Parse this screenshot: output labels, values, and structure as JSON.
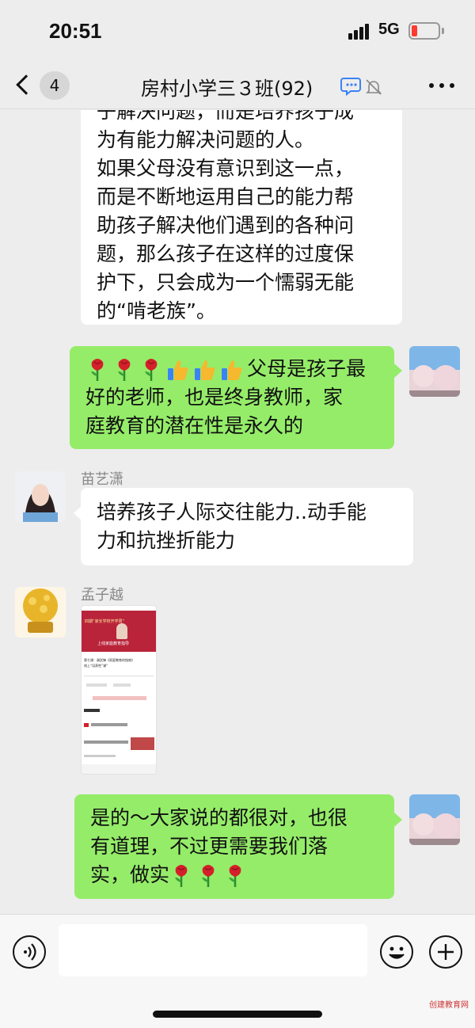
{
  "status_bar": {
    "time": "20:51",
    "network": "5G"
  },
  "nav": {
    "back_count": "4",
    "title": "房村小学三３班(92)"
  },
  "messages": [
    {
      "side": "left",
      "lines": [
        "子解决问题，而是培养孩子成",
        "为有能力解决问题的人。",
        "如果父母没有意识到这一点，",
        "而是不断地运用自己的能力帮",
        "助孩子解决他们遇到的各种问",
        "题，那么孩子在这样的过度保",
        "护下，只会成为一个懦弱无能",
        "的“啃老族”。"
      ]
    },
    {
      "side": "right",
      "first_line_text": "父母是孩子最",
      "lines": [
        "好的老师，也是终身教师，家",
        "庭教育的潜在性是永久的"
      ]
    },
    {
      "side": "left",
      "sender": "苗艺潇",
      "lines": [
        "培养孩子人际交往能力..动手能",
        "力和抗挫折能力"
      ]
    },
    {
      "side": "left",
      "sender": "孟子越",
      "type": "image",
      "image_texts": [
        "四期“家长学校开学周”",
        "上线家庭教育指导",
        "第七课：谢武锋《家庭教育的指南》",
        "线上“培养性”课“"
      ]
    },
    {
      "side": "right",
      "lines": [
        "是的～大家说的都很对，也很",
        "有道理，不过更需要我们落"
      ],
      "last_line_text": "实，做实"
    }
  ],
  "icons": {
    "back": "chevron-left-icon",
    "group_chat": "chat-bubble-icon",
    "mute": "bell-slash-icon",
    "more": "more-dots-icon",
    "voice": "voice-icon",
    "emoji": "smiley-icon",
    "plus": "plus-icon",
    "rose": "rose-emoji",
    "thumbs_up": "thumbs-up-emoji"
  },
  "colors": {
    "background": "#ededed",
    "bubble_self": "#95ec69",
    "bubble_other": "#ffffff",
    "battery_low": "#ff3b30",
    "accent_blue": "#3b82f6"
  },
  "watermark": "创建教育网"
}
